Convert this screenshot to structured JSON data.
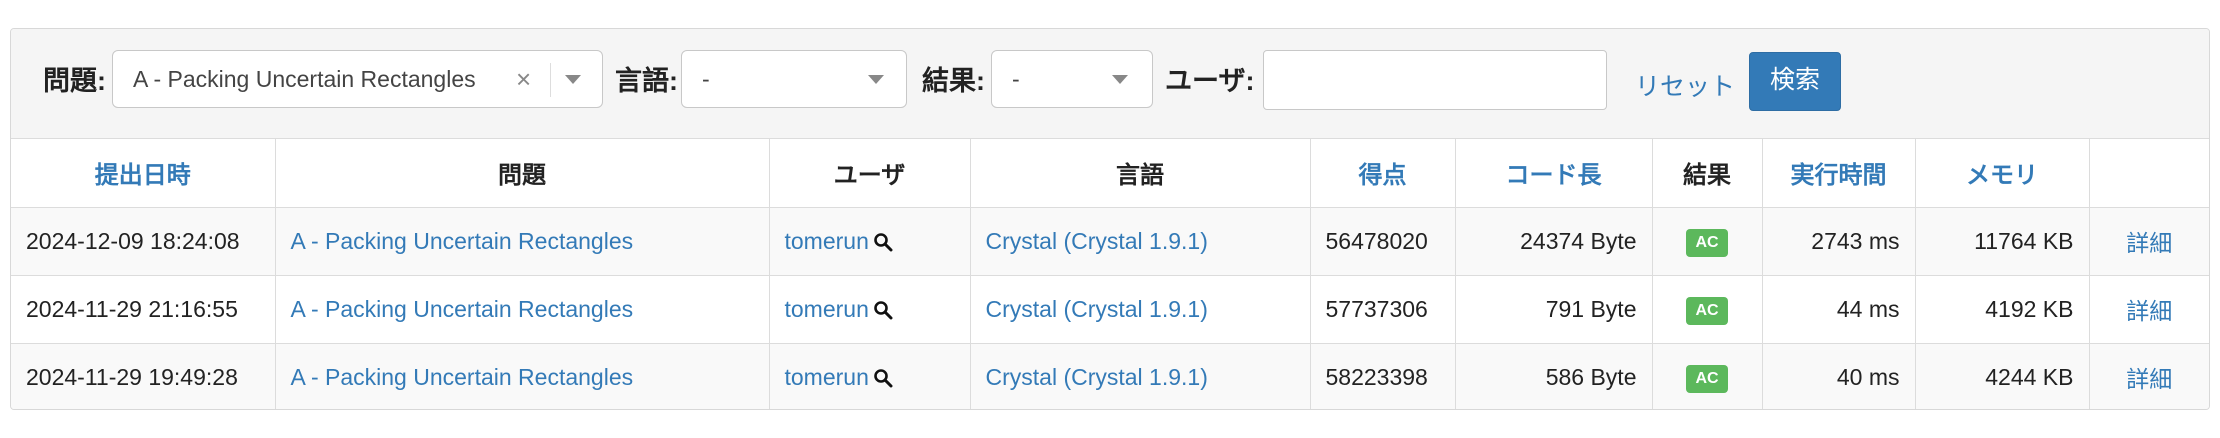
{
  "filters": {
    "problem_label": "問題:",
    "problem_value": "A - Packing Uncertain Rectangles",
    "clear_symbol": "×",
    "language_label": "言語:",
    "language_value": "-",
    "result_label": "結果:",
    "result_value": "-",
    "user_label": "ユーザ:",
    "user_value": "",
    "reset_label": "リセット",
    "search_label": "検索"
  },
  "table": {
    "headers": {
      "submit_time": "提出日時",
      "problem": "問題",
      "user": "ユーザ",
      "language": "言語",
      "score": "得点",
      "code_length": "コード長",
      "result": "結果",
      "exec_time": "実行時間",
      "memory": "メモリ",
      "detail": ""
    },
    "rows": [
      {
        "submit_time": "2024-12-09 18:24:08",
        "problem": "A - Packing Uncertain Rectangles",
        "user": "tomerun",
        "language": "Crystal (Crystal 1.9.1)",
        "score": "56478020",
        "code_length": "24374 Byte",
        "result": "AC",
        "exec_time": "2743 ms",
        "memory": "11764 KB",
        "detail": "詳細"
      },
      {
        "submit_time": "2024-11-29 21:16:55",
        "problem": "A - Packing Uncertain Rectangles",
        "user": "tomerun",
        "language": "Crystal (Crystal 1.9.1)",
        "score": "57737306",
        "code_length": "791 Byte",
        "result": "AC",
        "exec_time": "44 ms",
        "memory": "4192 KB",
        "detail": "詳細"
      },
      {
        "submit_time": "2024-11-29 19:49:28",
        "problem": "A - Packing Uncertain Rectangles",
        "user": "tomerun",
        "language": "Crystal (Crystal 1.9.1)",
        "score": "58223398",
        "code_length": "586 Byte",
        "result": "AC",
        "exec_time": "40 ms",
        "memory": "4244 KB",
        "detail": "詳細"
      }
    ]
  },
  "colors": {
    "link": "#337ab7",
    "ac_badge": "#5cb85c",
    "primary_button": "#337ab7"
  },
  "icons": {
    "user_search": "magnifying-glass-icon",
    "dropdown": "caret-down-icon"
  }
}
